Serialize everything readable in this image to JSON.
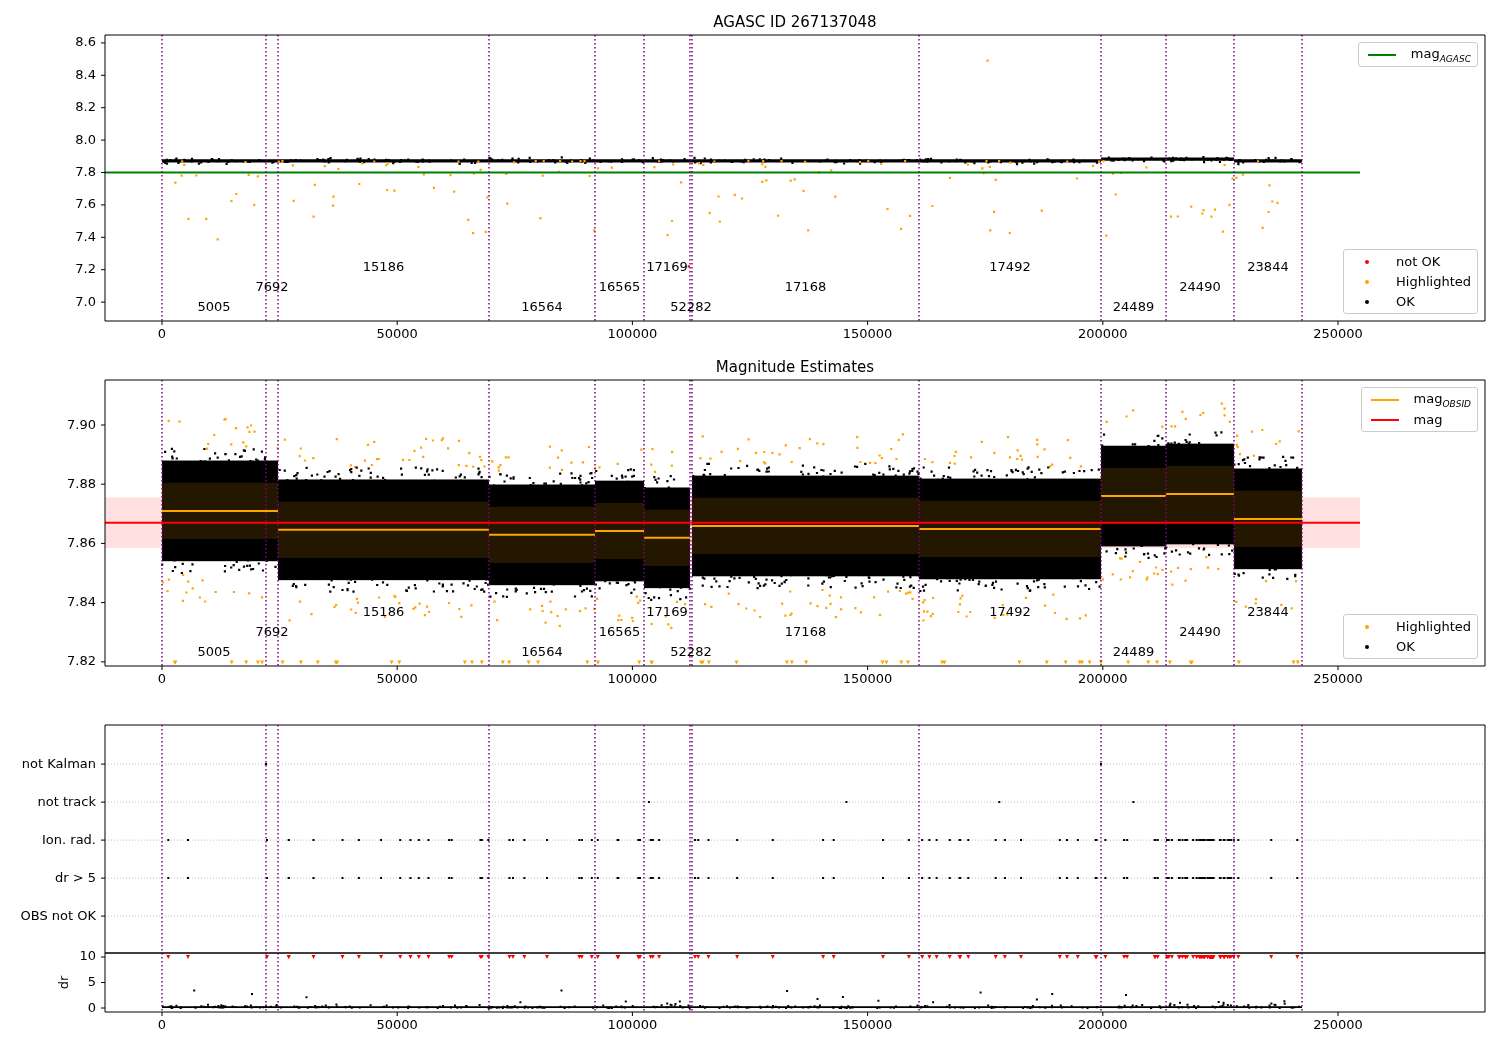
{
  "figure": {
    "panels": [
      {
        "kind": "agasc",
        "title": "AGASC ID 267137048",
        "chart_data": {
          "type": "scatter",
          "xlim": [
            -12117,
            281250
          ],
          "ylim": [
            6.883,
            8.649
          ],
          "xticks": [
            0,
            50000,
            100000,
            150000,
            200000,
            250000
          ],
          "yticks": [
            {
              "value": 7.0,
              "label": "7.0"
            },
            {
              "value": 7.2,
              "label": "7.2"
            },
            {
              "value": 7.4,
              "label": "7.4"
            },
            {
              "value": 7.6,
              "label": "7.6"
            },
            {
              "value": 7.8,
              "label": "7.8"
            },
            {
              "value": 8.0,
              "label": "8.0"
            },
            {
              "value": 8.2,
              "label": "8.2"
            },
            {
              "value": 8.4,
              "label": "8.4"
            },
            {
              "value": 8.6,
              "label": "8.6"
            }
          ],
          "series": [
            {
              "type": "line",
              "color": "#008000",
              "x": [
                -12117,
                254677
              ],
              "values": [
                7.8,
                7.8
              ]
            }
          ],
          "ref_lines": [
            {
              "axis": "x",
              "value": 0
            },
            {
              "axis": "x",
              "value": 22109
            },
            {
              "axis": "x",
              "value": 24660
            },
            {
              "axis": "x",
              "value": 69515
            },
            {
              "axis": "x",
              "value": 92049
            },
            {
              "axis": "x",
              "value": 102466
            },
            {
              "axis": "x",
              "value": 112245
            },
            {
              "axis": "x",
              "value": 112670
            },
            {
              "axis": "x",
              "value": 160927
            },
            {
              "axis": "x",
              "value": 199617
            },
            {
              "axis": "x",
              "value": 213435
            },
            {
              "axis": "x",
              "value": 227891
            },
            {
              "axis": "x",
              "value": 242347
            }
          ],
          "annotations": [
            "5005",
            "7692",
            "15186",
            "16564",
            "16565",
            "17169",
            "52282",
            "17168",
            "17492",
            "24489",
            "24490",
            "23844"
          ]
        },
        "legends": [
          {
            "entries": [
              {
                "kind": "line",
                "label": "mag$_{AGASC}$",
                "color": "#008000"
              }
            ]
          },
          {
            "entries": [
              {
                "kind": "marker",
                "label": "not OK",
                "color": "#ff0000"
              },
              {
                "kind": "marker",
                "label": "Highlighted",
                "color": "#ffa500"
              },
              {
                "kind": "marker",
                "label": "OK",
                "color": "#000000"
              }
            ]
          }
        ]
      },
      {
        "kind": "obsid",
        "title": "Magnitude Estimates",
        "chart_data": {
          "type": "scatter",
          "xlim": [
            -12117,
            281250
          ],
          "ylim": [
            7.8186,
            7.9152
          ],
          "xticks": [
            0,
            50000,
            100000,
            150000,
            200000,
            250000
          ],
          "yticks": [
            {
              "value": 7.82,
              "label": "7.82"
            },
            {
              "value": 7.84,
              "label": "7.84"
            },
            {
              "value": 7.86,
              "label": "7.86"
            },
            {
              "value": 7.88,
              "label": "7.88"
            },
            {
              "value": 7.9,
              "label": "7.90"
            }
          ],
          "series": [
            {
              "type": "line",
              "color": "#ffa500",
              "x": [
                0,
                24660,
                null,
                24660,
                69515,
                null,
                69515,
                92049,
                null,
                92049,
                102466,
                null,
                102466,
                112245,
                null,
                112670,
                160927,
                null,
                160927,
                199617,
                null,
                199617,
                213435,
                null,
                213435,
                227891,
                null,
                227891,
                242347
              ],
              "values": [
                7.871,
                7.871,
                null,
                7.8646,
                7.8646,
                null,
                7.8629,
                7.8629,
                null,
                7.8642,
                7.8642,
                null,
                7.8619,
                7.8619,
                null,
                7.8659,
                7.8659,
                null,
                7.8649,
                7.8649,
                null,
                7.876,
                7.876,
                null,
                7.8767,
                7.8767,
                null,
                7.8683,
                7.8683
              ]
            },
            {
              "type": "line",
              "color": "#ff0000",
              "x": [
                -12117,
                254677
              ],
              "values": [
                7.867,
                7.867
              ]
            }
          ],
          "ref_lines": [
            {
              "axis": "x",
              "value": 0
            },
            {
              "axis": "x",
              "value": 22109
            },
            {
              "axis": "x",
              "value": 24660
            },
            {
              "axis": "x",
              "value": 69515
            },
            {
              "axis": "x",
              "value": 92049
            },
            {
              "axis": "x",
              "value": 102466
            },
            {
              "axis": "x",
              "value": 112245
            },
            {
              "axis": "x",
              "value": 112670
            },
            {
              "axis": "x",
              "value": 160927
            },
            {
              "axis": "x",
              "value": 199617
            },
            {
              "axis": "x",
              "value": 213435
            },
            {
              "axis": "x",
              "value": 227891
            },
            {
              "axis": "x",
              "value": 242347
            }
          ],
          "annotations": [
            "5005",
            "7692",
            "15186",
            "16564",
            "16565",
            "17169",
            "52282",
            "17168",
            "17492",
            "24489",
            "24490",
            "23844"
          ]
        },
        "legends": [
          {
            "entries": [
              {
                "kind": "line",
                "label": "mag$_{OBSID}$",
                "color": "#ffa500"
              },
              {
                "kind": "line",
                "label": "mag",
                "color": "#ff0000"
              }
            ]
          },
          {
            "entries": [
              {
                "kind": "marker",
                "label": "Highlighted",
                "color": "#ffa500"
              },
              {
                "kind": "marker",
                "label": "OK",
                "color": "#000000"
              }
            ]
          }
        ]
      },
      {
        "kind": "flags",
        "row_labels": [
          "not Kalman",
          "not track",
          "Ion. rad.",
          "dr > 5",
          "OBS not OK"
        ]
      },
      {
        "kind": "dr",
        "chart_data": {
          "type": "scatter",
          "ylabel": "dr",
          "xlim": [
            -12117,
            281250
          ],
          "ylim": [
            -0.78,
            10.78
          ],
          "xticks": [
            0,
            50000,
            100000,
            150000,
            200000,
            250000
          ],
          "yticks": [
            0,
            5,
            10
          ],
          "ref_lines": [
            {
              "axis": "x",
              "value": 0
            },
            {
              "axis": "x",
              "value": 22109
            },
            {
              "axis": "x",
              "value": 24660
            },
            {
              "axis": "x",
              "value": 69515
            },
            {
              "axis": "x",
              "value": 92049
            },
            {
              "axis": "x",
              "value": 102466
            },
            {
              "axis": "x",
              "value": 112245
            },
            {
              "axis": "x",
              "value": 112670
            },
            {
              "axis": "x",
              "value": 160927
            },
            {
              "axis": "x",
              "value": 199617
            },
            {
              "axis": "x",
              "value": 213435
            },
            {
              "axis": "x",
              "value": 227891
            },
            {
              "axis": "x",
              "value": 242347
            }
          ]
        }
      }
    ]
  }
}
